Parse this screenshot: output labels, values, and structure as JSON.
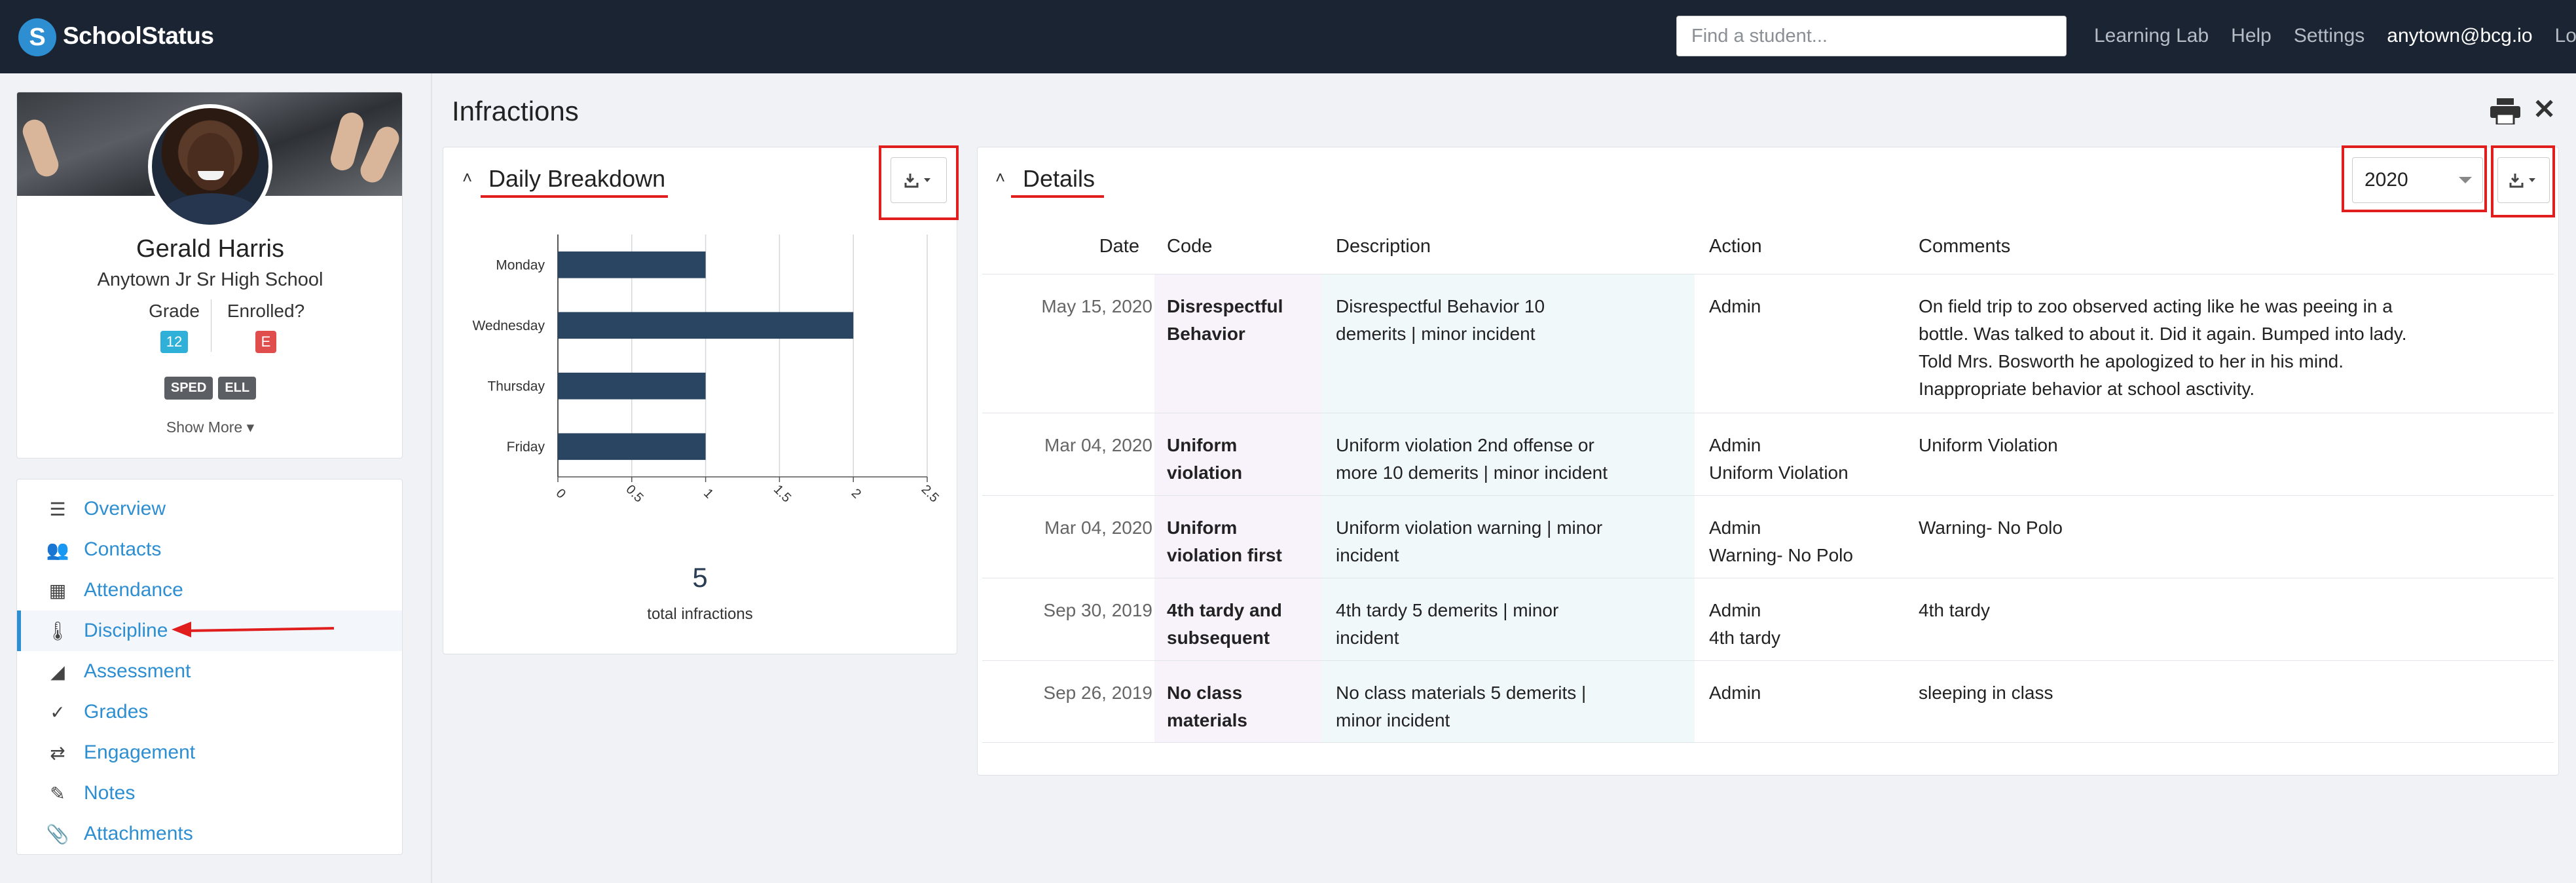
{
  "app": {
    "name": "SchoolStatus",
    "logo_letter": "S"
  },
  "topnav": {
    "search_placeholder": "Find a student...",
    "links": [
      "Learning Lab",
      "Help",
      "Settings"
    ],
    "email": "anytown@bcg.io",
    "logout": "Logout"
  },
  "profile": {
    "name": "Gerald Harris",
    "school": "Anytown Jr Sr High School",
    "grade_label": "Grade",
    "grade_value": "12",
    "enrolled_label": "Enrolled?",
    "enrolled_value": "E",
    "tags": [
      "SPED",
      "ELL"
    ],
    "show_more": "Show More ▾"
  },
  "sidebar": {
    "items": [
      {
        "label": "Overview",
        "icon": "list-icon",
        "glyph": "☰"
      },
      {
        "label": "Contacts",
        "icon": "contacts-icon",
        "glyph": "👥"
      },
      {
        "label": "Attendance",
        "icon": "calendar-icon",
        "glyph": "▦"
      },
      {
        "label": "Discipline",
        "icon": "thermometer-icon",
        "glyph": "🌡"
      },
      {
        "label": "Assessment",
        "icon": "chart-icon",
        "glyph": "◢"
      },
      {
        "label": "Grades",
        "icon": "check-icon",
        "glyph": "✓"
      },
      {
        "label": "Engagement",
        "icon": "arrows-icon",
        "glyph": "⇄"
      },
      {
        "label": "Notes",
        "icon": "pencil-icon",
        "glyph": "✎"
      },
      {
        "label": "Attachments",
        "icon": "paperclip-icon",
        "glyph": "📎"
      }
    ],
    "active_index": 3
  },
  "main": {
    "title": "Infractions",
    "daily": {
      "title": "Daily Breakdown",
      "total_value": "5",
      "total_label": "total infractions"
    },
    "details": {
      "title": "Details",
      "year": "2020",
      "columns": [
        "Date",
        "Code",
        "Description",
        "Action",
        "Comments"
      ],
      "rows": [
        {
          "date": "May 15, 2020",
          "code": [
            "Disrespectful",
            "Behavior"
          ],
          "desc": [
            "Disrespectful Behavior 10",
            "demerits | minor incident"
          ],
          "action": [
            "Admin"
          ],
          "comments": [
            "On field trip to zoo observed acting like he was peeing in a",
            "bottle. Was talked to about it. Did it again.  Bumped into lady.",
            "Told Mrs. Bosworth he apologized to her in his mind.",
            "Inappropriate behavior at school asctivity."
          ]
        },
        {
          "date": "Mar 04, 2020",
          "code": [
            "Uniform",
            "violation"
          ],
          "desc": [
            "Uniform violation 2nd offense or",
            "more 10 demerits | minor incident"
          ],
          "action": [
            "Admin",
            "Uniform Violation"
          ],
          "comments": [
            "Uniform Violation"
          ]
        },
        {
          "date": "Mar 04, 2020",
          "code": [
            "Uniform",
            "violation first"
          ],
          "desc": [
            "Uniform violation warning | minor",
            "incident"
          ],
          "action": [
            "Admin",
            "Warning- No Polo"
          ],
          "comments": [
            "Warning- No Polo"
          ]
        },
        {
          "date": "Sep 30, 2019",
          "code": [
            "4th tardy and",
            "subsequent"
          ],
          "desc": [
            "4th tardy 5 demerits | minor",
            "incident"
          ],
          "action": [
            "Admin",
            "4th tardy"
          ],
          "comments": [
            "4th tardy"
          ]
        },
        {
          "date": "Sep 26, 2019",
          "code": [
            "No class",
            "materials"
          ],
          "desc": [
            "No class materials 5 demerits |",
            "minor incident"
          ],
          "action": [
            "Admin"
          ],
          "comments": [
            "sleeping in class"
          ]
        }
      ]
    }
  },
  "colors": {
    "accent": "#2d8ed2",
    "bar": "#2a4562",
    "annotation": "#e01e1e",
    "nav_bg": "#1b2433"
  },
  "chart_data": {
    "type": "bar",
    "orientation": "horizontal",
    "categories": [
      "Monday",
      "Wednesday",
      "Thursday",
      "Friday"
    ],
    "values": [
      1,
      2,
      1,
      1
    ],
    "xlim": [
      0,
      2.5
    ],
    "xticks": [
      "0",
      "0.5",
      "1",
      "1.5",
      "2",
      "2.5"
    ],
    "grid": true
  }
}
